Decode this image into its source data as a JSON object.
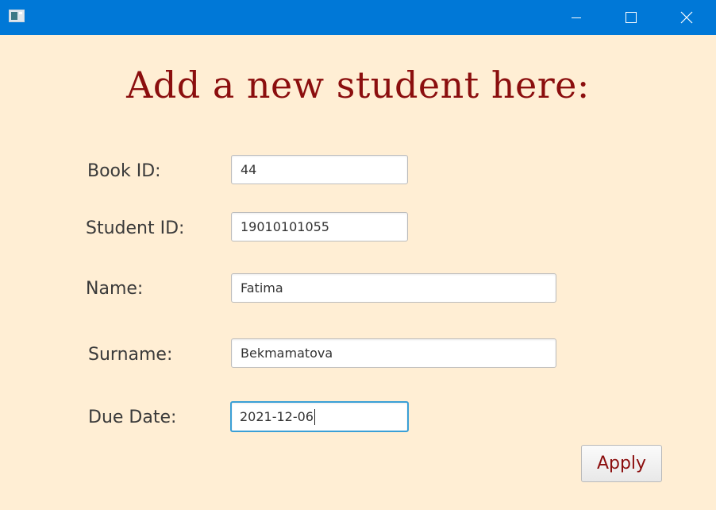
{
  "window": {
    "minimize_label": "",
    "maximize_label": "",
    "close_label": ""
  },
  "heading": "Add a new student here:",
  "form": {
    "book_id": {
      "label": "Book ID:",
      "value": "44"
    },
    "student_id": {
      "label": "Student ID:",
      "value": "19010101055"
    },
    "name": {
      "label": "Name:",
      "value": "Fatima"
    },
    "surname": {
      "label": "Surname:",
      "value": "Bekmamatova"
    },
    "due_date": {
      "label": "Due Date:",
      "value": "2021-12-06"
    }
  },
  "apply_label": "Apply",
  "colors": {
    "titlebar": "#0078d7",
    "background": "#ffeed4",
    "heading": "#8b0e0e",
    "focus_border": "#3a9fd6"
  },
  "icons": {
    "app": "app-window-icon",
    "minimize": "minimize-icon",
    "maximize": "maximize-icon",
    "close": "close-icon"
  }
}
